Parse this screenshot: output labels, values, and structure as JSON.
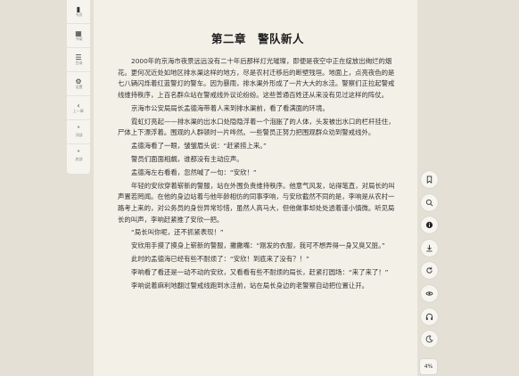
{
  "left_toolbar": {
    "items": [
      {
        "icon": "book-icon",
        "label": "书页"
      },
      {
        "icon": "grid-icon",
        "label": "书架"
      },
      {
        "icon": "list-icon",
        "label": "目录"
      },
      {
        "icon": "gear-icon",
        "label": "设置"
      },
      {
        "icon": "chevron-left-icon",
        "label": "上一章"
      },
      {
        "icon": "chevron-up-icon",
        "label": "顶部"
      },
      {
        "icon": "chevron-down-icon",
        "label": "底部"
      }
    ]
  },
  "chapter": {
    "title": "第二章　警队新人",
    "paragraphs": [
      "2000年的京海市夜景远远没有二十年后那样灯光璀璨，即便是夜空中正在绽放出绚烂的烟花。更何况近处如地区排水渠这样的地方，尽是农村迁移后的断壁残垣。地面上，点亮夜色的是七八辆闪烁着红蓝警灯的警车。因为暴雨，排水渠外形成了一片大大的水洼。警察们正拉起警戒线维持秩序，上百名群众站在警戒线外议论纷纷。这些普通百姓还从来没有见过这样的阵仗。",
      "京海市公安局局长孟德海带着人来到排水渠前，看了看满面的环境。",
      "霓虹灯亮起——排水渠的出水口处隐隐浮着一个泡胀了的人体，头发被出水口的栏杆挂住，尸体上下漂浮着。围观的人群顿时一片哗然。一些警员正努力把围观群众劝到警戒线外。",
      "孟德海看了一眼，皱皱眉头说：“赶紧捞上来。”",
      "警员们面面相觑，谁都没有主动应声。",
      "孟德海左右看看，忽然喊了一句：“安欣！”",
      "年轻的安欣穿着崭新的警服，站在外围负责维持秩序。他意气风发，站得笔直，对局长的叫声置若罔闻。在他的身边站着与他年龄相仿的同事李响，与安欣截然不同的是，李响是从农村一路考上来的，对公务员的身份异常珍惜，虽然人高马大，但他做事却处处透着谨小慎微。听见局长的叫声，李响赶紧推了安欣一把。",
      "“局长叫你呢，还不抓紧表现！”",
      "安欣用手摸了摸身上崭新的警服，撇撇嘴：“刚发的衣服，我可不想弄得一身又臭又脏。”",
      "此时的孟德海已经有些不耐烦了：“安欣！到底来了没有？！”",
      "李响看了看还是一动不动的安欣，又看看有些不耐烦的局长，赶紧打圆场：“来了来了！”",
      "李响说着麻利地翻过警戒线跑到水洼前，站在局长身边的老警察自动把位置让开。"
    ]
  },
  "right_toolbar": {
    "buttons": [
      {
        "icon": "bookmark-icon"
      },
      {
        "icon": "search-icon"
      },
      {
        "icon": "info-icon"
      },
      {
        "icon": "download-icon"
      },
      {
        "icon": "refresh-icon"
      },
      {
        "icon": "eye-icon"
      },
      {
        "icon": "headphones-icon"
      },
      {
        "icon": "moon-icon"
      }
    ]
  },
  "progress": {
    "label": "4%"
  }
}
